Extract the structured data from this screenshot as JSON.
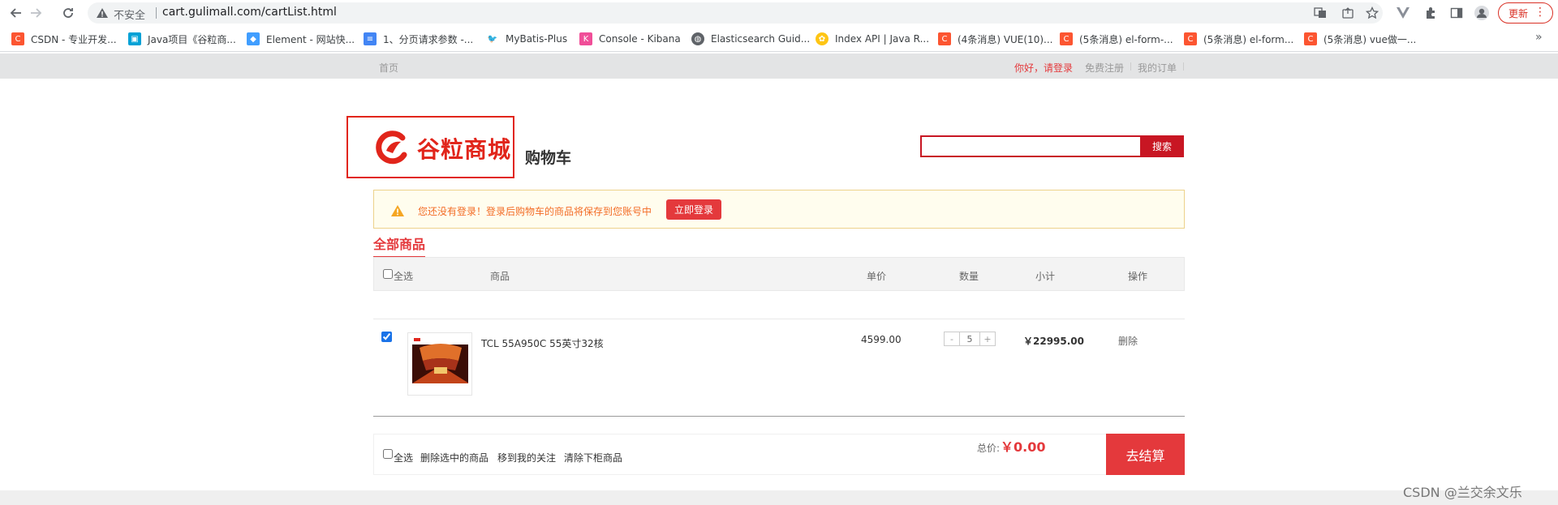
{
  "browser": {
    "insecure_label": "不安全",
    "url": "cart.gulimall.com/cartList.html",
    "update_label": "更新",
    "bookmarks": [
      {
        "label": "CSDN - 专业开发...",
        "color": "#fc5531"
      },
      {
        "label": "Java项目《谷粒商...",
        "color": "#00a1d6"
      },
      {
        "label": "Element - 网站快...",
        "color": "#409eff"
      },
      {
        "label": "1、分页请求参数 -...",
        "color": "#4285f4"
      },
      {
        "label": "MyBatis-Plus",
        "color": "#333333"
      },
      {
        "label": "Console - Kibana",
        "color": "#f04e98"
      },
      {
        "label": "Elasticsearch Guid...",
        "color": "#5f6368"
      },
      {
        "label": "Index API | Java R...",
        "color": "#fec514"
      },
      {
        "label": "(4条消息) VUE(10)...",
        "color": "#fc5531"
      },
      {
        "label": "(5条消息) el-form-...",
        "color": "#fc5531"
      },
      {
        "label": "(5条消息) el-form...",
        "color": "#fc5531"
      },
      {
        "label": "(5条消息) vue做一...",
        "color": "#fc5531"
      }
    ]
  },
  "topbar": {
    "home": "首页",
    "greeting": "你好，请登录",
    "register": "免费注册",
    "orders": "我的订单"
  },
  "header": {
    "logo_text": "谷粒商城",
    "page_title": "购物车",
    "search_button": "搜索"
  },
  "notice": {
    "message": "您还没有登录！登录后购物车的商品将保存到您账号中",
    "login_button": "立即登录"
  },
  "cart": {
    "tab_label": "全部商品",
    "columns": {
      "select_all": "全选",
      "product": "商品",
      "unit_price": "单价",
      "quantity": "数量",
      "subtotal": "小计",
      "action": "操作"
    },
    "items": [
      {
        "name": "TCL 55A950C 55英寸32核",
        "price": "4599.00",
        "qty_minus": "-",
        "quantity": "5",
        "qty_plus": "+",
        "subtotal": "￥22995.00",
        "delete": "删除",
        "checked": true
      }
    ]
  },
  "footer": {
    "select_all": "全选",
    "delete_selected": "删除选中的商品",
    "move_to_favorites": "移到我的关注",
    "clear_offshelf": "清除下柜商品",
    "total_label": "总价:",
    "total_value": "￥0.00",
    "checkout": "去结算"
  },
  "watermark": "CSDN @兰交余文乐",
  "colors": {
    "brand_red": "#e4393c",
    "search_red": "#c81623",
    "notice_text": "#f36c26"
  }
}
